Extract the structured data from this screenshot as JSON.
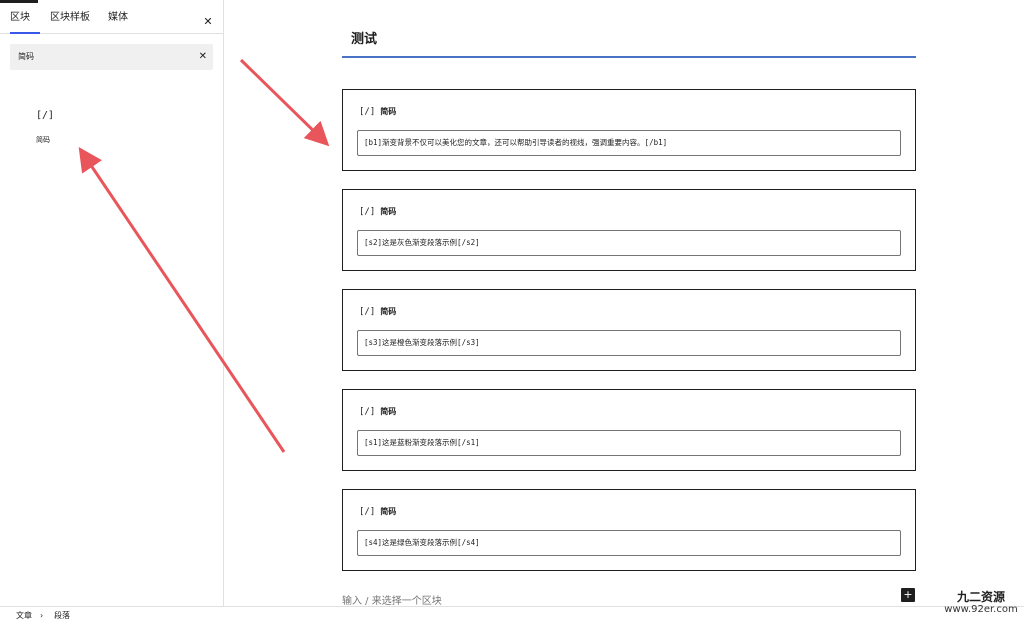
{
  "sidebar": {
    "tabs": [
      {
        "label": "区块",
        "active": true
      },
      {
        "label": "区块样板",
        "active": false
      },
      {
        "label": "媒体",
        "active": false
      }
    ],
    "close_icon": "close-icon",
    "search": {
      "value": "简码",
      "clear_icon": "close-icon"
    },
    "results": [
      {
        "icon": "[/]",
        "label": "简码"
      }
    ]
  },
  "editor": {
    "title": "测试",
    "blocks": [
      {
        "icon": "[/]",
        "name": "简码",
        "value": "[b1]渐变背景不仅可以美化您的文章，还可以帮助引导读者的视线，强调重要内容。[/b1]"
      },
      {
        "icon": "[/]",
        "name": "简码",
        "value": "[s2]这是灰色渐变段落示例[/s2]"
      },
      {
        "icon": "[/]",
        "name": "简码",
        "value": "[s3]这是橙色渐变段落示例[/s3]"
      },
      {
        "icon": "[/]",
        "name": "简码",
        "value": "[s1]这是蓝粉渐变段落示例[/s1]"
      },
      {
        "icon": "[/]",
        "name": "简码",
        "value": "[s4]这是绿色渐变段落示例[/s4]"
      }
    ],
    "appender_placeholder": "输入 / 来选择一个区块",
    "add_block_icon": "plus-icon"
  },
  "breadcrumb": {
    "items": [
      "文章",
      "段落"
    ],
    "separator": "›"
  },
  "watermark": {
    "line1": "九二资源",
    "line2": "www.92er.com"
  },
  "colors": {
    "accent": "#3858e9",
    "title_rule": "#4a72c4",
    "arrow": "#e8555a"
  }
}
